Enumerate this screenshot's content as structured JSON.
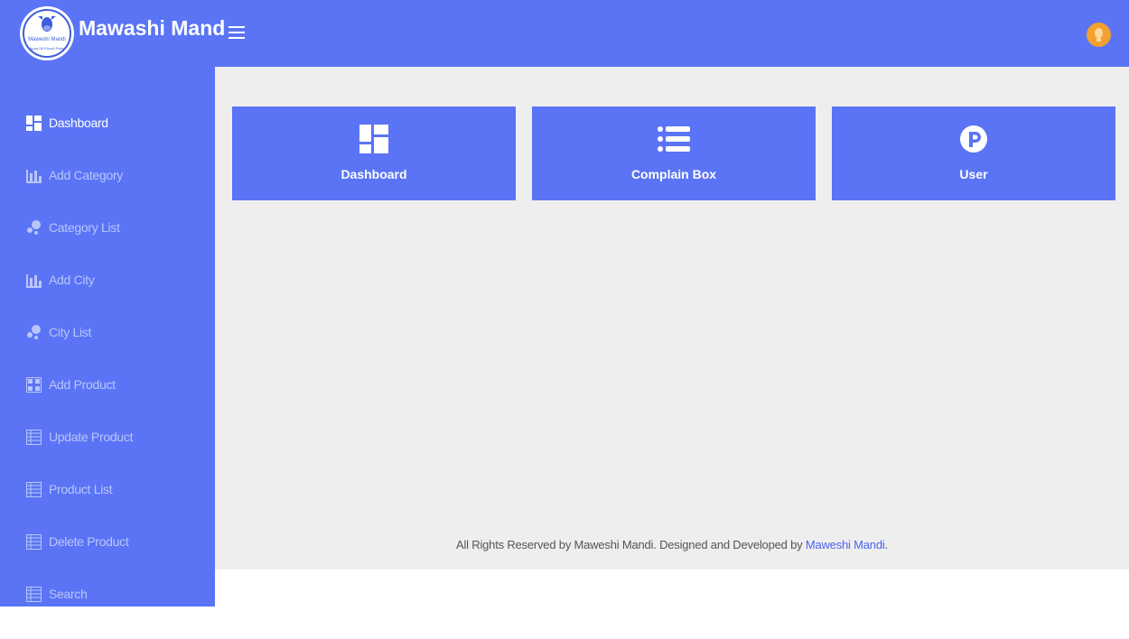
{
  "header": {
    "app_title": "Mawashi Mand",
    "logo_text": "Maweshi Mandi",
    "logo_subtext": "Apna Dil Khush Raho",
    "menu_icon": "hamburger-icon",
    "avatar_icon": "lightbulb-icon"
  },
  "sidebar": {
    "items": [
      {
        "label": "Dashboard",
        "icon": "dashboard-icon",
        "active": true
      },
      {
        "label": "Add Category",
        "icon": "bar-chart-icon"
      },
      {
        "label": "Category List",
        "icon": "bubbles-icon"
      },
      {
        "label": "Add City",
        "icon": "bar-chart-icon"
      },
      {
        "label": "City List",
        "icon": "bubbles-icon"
      },
      {
        "label": "Add Product",
        "icon": "grid-add-icon"
      },
      {
        "label": "Update Product",
        "icon": "table-icon"
      },
      {
        "label": "Product List",
        "icon": "table-icon"
      },
      {
        "label": "Delete Product",
        "icon": "table-icon"
      },
      {
        "label": "Search",
        "icon": "table-icon"
      }
    ]
  },
  "cards": [
    {
      "label": "Dashboard",
      "icon": "dashboard-icon"
    },
    {
      "label": "Complain Box",
      "icon": "list-icon"
    },
    {
      "label": "User",
      "icon": "parking-p-icon"
    }
  ],
  "footer": {
    "text": "All Rights Reserved by Maweshi Mandi. Designed and Developed by",
    "link": "Maweshi Mandi",
    "end": "."
  },
  "colors": {
    "primary": "#5a74f5",
    "sidebar_label": "#b9c6fb",
    "content_bg": "#eeeeee",
    "avatar": "#f2a030"
  }
}
